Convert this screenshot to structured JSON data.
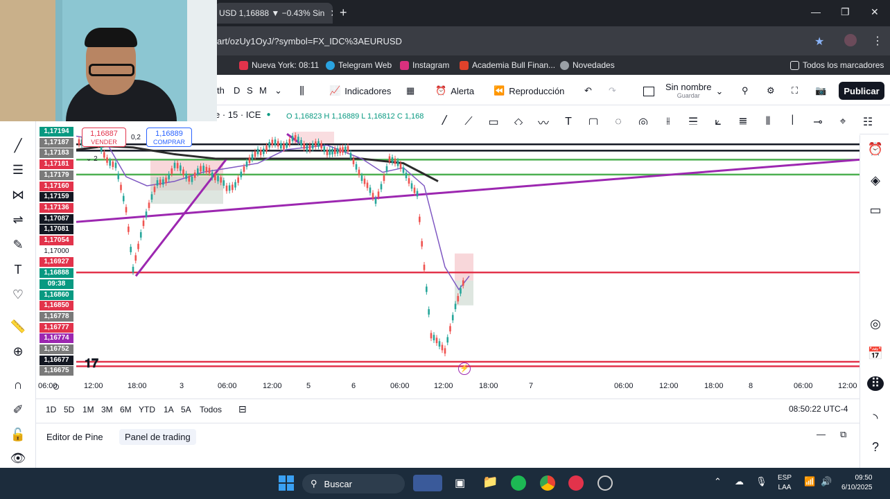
{
  "browser": {
    "tab_title": "USD 1,16888 ▼ −0.43% Sin",
    "tab_close": "✕",
    "new_tab": "+",
    "url": "art/ozUy1OyJ/?symbol=FX_IDC%3AEURUSD",
    "bookmarks": [
      {
        "label": "Nueva York: 08:11",
        "color": "#e2334b"
      },
      {
        "label": "Telegram Web",
        "color": "#2aa3e0"
      },
      {
        "label": "Instagram",
        "color": "#d9307e"
      },
      {
        "label": "Academia Bull Finan...",
        "color": "#e0422b"
      },
      {
        "label": "Novedades",
        "color": "#9aa0a6"
      }
    ],
    "all_bookmarks": "Todos los marcadores"
  },
  "toolbar": {
    "intervals": [
      "th",
      "D",
      "S",
      "M"
    ],
    "indicators": "Indicadores",
    "alert": "Alerta",
    "replay": "Reproducción",
    "layout_name": "Sin nombre",
    "layout_sub": "Guardar",
    "publish": "Publicar"
  },
  "symbol": {
    "name": "e · 15 · ICE",
    "ohlc": "O 1,16823  H 1,16889  L 1,16812  C 1,168"
  },
  "order": {
    "sell_price": "1,16887",
    "sell_label": "VENDER",
    "spread": "0,2",
    "buy_price": "1,16889",
    "buy_label": "COMPRAR",
    "count": "2"
  },
  "price_labels": [
    {
      "text": "1,17194",
      "bg": "#089981",
      "y": 1.17194
    },
    {
      "text": "1,17187",
      "bg": "#7a7a7a",
      "y": 1.17187
    },
    {
      "text": "1,17183",
      "bg": "#7a7a7a",
      "y": 1.17183
    },
    {
      "text": "1,17181",
      "bg": "#e2334b",
      "y": 1.17181
    },
    {
      "text": "1,17179",
      "bg": "#7a7a7a",
      "y": 1.17179
    },
    {
      "text": "1,17160",
      "bg": "#e2334b",
      "y": 1.1716
    },
    {
      "text": "1,17159",
      "bg": "#131722",
      "y": 1.17159
    },
    {
      "text": "1,17136",
      "bg": "#e2334b",
      "y": 1.17136
    },
    {
      "text": "1,17087",
      "bg": "#131722",
      "y": 1.17087
    },
    {
      "text": "1,17081",
      "bg": "#131722",
      "y": 1.17081
    },
    {
      "text": "1,17054",
      "bg": "#e2334b",
      "y": 1.17054
    },
    {
      "text": "1,17000",
      "bg": "none",
      "y": 1.17
    },
    {
      "text": "1,16927",
      "bg": "#e2334b",
      "y": 1.16927
    },
    {
      "text": "1,16888",
      "bg": "#089981",
      "y": 1.16888
    },
    {
      "text": "09:38",
      "bg": "#089981",
      "y": 1.1687
    },
    {
      "text": "1,16860",
      "bg": "#089981",
      "y": 1.1686
    },
    {
      "text": "1,16850",
      "bg": "#e2334b",
      "y": 1.1685
    },
    {
      "text": "1,16778",
      "bg": "#7a7a7a",
      "y": 1.16778
    },
    {
      "text": "1,16777",
      "bg": "#e2334b",
      "y": 1.16777
    },
    {
      "text": "1,16774",
      "bg": "#9c27b0",
      "y": 1.16774
    },
    {
      "text": "1,16752",
      "bg": "#7a7a7a",
      "y": 1.16752
    },
    {
      "text": "1,16677",
      "bg": "#131722",
      "y": 1.16677
    },
    {
      "text": "1,16675",
      "bg": "#7a7a7a",
      "y": 1.16675
    }
  ],
  "time_labels": [
    "06:00",
    "12:00",
    "18:00",
    "3",
    "06:00",
    "12:00",
    "5",
    "6",
    "06:00",
    "12:00",
    "18:00",
    "7",
    "06:00",
    "12:00",
    "18:00",
    "8",
    "06:00",
    "12:00"
  ],
  "ranges": [
    "1D",
    "5D",
    "1M",
    "3M",
    "6M",
    "YTD",
    "1A",
    "5A",
    "Todos"
  ],
  "clock": "08:50:22 UTC-4",
  "bottom_tabs": [
    "Editor de Pine",
    "Panel de trading"
  ],
  "taskbar": {
    "search": "Buscar",
    "lang1": "ESP",
    "lang2": "LAA",
    "time": "09:50",
    "date": "6/10/2025"
  },
  "colors": {
    "red_line": "#e2334b",
    "green_line": "#4caf50",
    "purple_line": "#9c27b0",
    "black_line": "#131722"
  }
}
